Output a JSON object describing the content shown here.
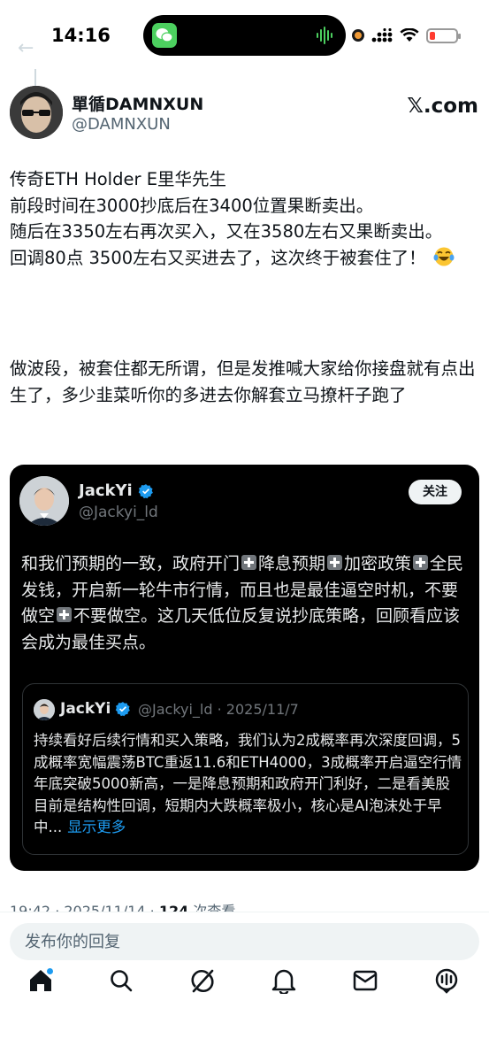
{
  "status_bar": {
    "time": "14:16",
    "battery_color": "#ff3b30",
    "rec_color": "#f09a36"
  },
  "post": {
    "author_name": "單循DAMNXUN",
    "author_handle": "@DAMNXUN",
    "source": "𝕏.com",
    "text_para1": "传奇ETH Holder E里华先生\n前段时间在3000抄底后在3400位置果断卖出。\n随后在3350左右再次买入，又在3580左右又果断卖出。\n回调80点 3500左右又买进去了，这次终于被套住了！",
    "text_para2": "做波段，被套住都无所谓，但是发推喊大家给你接盘就有点出生了，多少韭菜听你的多进去你解套立马撩杆子跑了",
    "emoji": "laughing-tears"
  },
  "quote": {
    "name": "JackYi",
    "handle": "@Jackyi_ld",
    "follow_label": "关注",
    "text_part1": "和我们预期的一致，政府开门",
    "text_part2": "降息预期",
    "text_part3": "加密政策",
    "text_part4": "全民发钱，开启新一轮牛市行情，而且也是最佳逼空时机，不要做空",
    "text_part5": "不要做空。这几天低位反复说抄底策略，回顾看应该会成为最佳买点。",
    "nested": {
      "name": "JackYi",
      "meta": "@Jackyi_ld · 2025/11/7",
      "text": "持续看好后续行情和买入策略，我们认为2成概率再次深度回调，5成概率宽幅震荡BTC重返11.6和ETH4000，3成概率开启逼空行情年底突破5000新高，一是降息预期和政府开门利好，二是看美股目前是结构性回调，短期内大跌概率极小，核心是AI泡沫处于早中...",
      "more_label": "显示更多"
    }
  },
  "meta": {
    "time_date": "19:42 · 2025/11/14 · ",
    "views": "124",
    "views_label": " 次查看"
  },
  "reply": {
    "placeholder": "发布你的回复"
  },
  "tabs": [
    "home-icon",
    "search-icon",
    "grok-icon",
    "notifications-icon",
    "messages-icon",
    "spaces-icon"
  ],
  "colors": {
    "accent": "#1d9bf0",
    "text": "#0f1419",
    "secondary": "#536471",
    "card_bg": "#000000"
  }
}
